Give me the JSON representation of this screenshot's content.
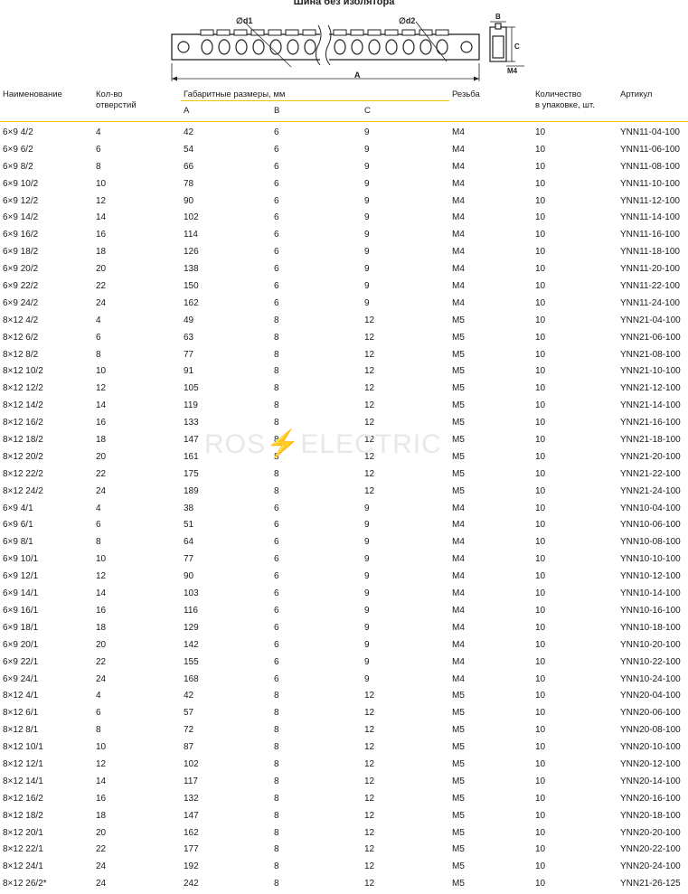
{
  "title": "Шина без изолятора",
  "drawing": {
    "d1_label": "∅d1",
    "d2_label": "∅d2",
    "a_label": "A",
    "b_label": "B",
    "c_label": "C",
    "m_label": "M4"
  },
  "header": {
    "name": "Наименование",
    "holes_line1": "Кол-во",
    "holes_line2": "отверстий",
    "dims": "Габаритные размеры, мм",
    "dim_a": "A",
    "dim_b": "B",
    "dim_c": "C",
    "thread": "Резьба",
    "qty_line1": "Количество",
    "qty_line2": "в упаковке, шт.",
    "article": "Артикул"
  },
  "watermark": {
    "left": "ROS",
    "bolt": "⚡",
    "right": "ELECTRIC"
  },
  "rows": [
    [
      "6×9 4/2",
      "4",
      "42",
      "6",
      "9",
      "M4",
      "10",
      "YNN11-04-100"
    ],
    [
      "6×9 6/2",
      "6",
      "54",
      "6",
      "9",
      "M4",
      "10",
      "YNN11-06-100"
    ],
    [
      "6×9 8/2",
      "8",
      "66",
      "6",
      "9",
      "M4",
      "10",
      "YNN11-08-100"
    ],
    [
      "6×9 10/2",
      "10",
      "78",
      "6",
      "9",
      "M4",
      "10",
      "YNN11-10-100"
    ],
    [
      "6×9 12/2",
      "12",
      "90",
      "6",
      "9",
      "M4",
      "10",
      "YNN11-12-100"
    ],
    [
      "6×9 14/2",
      "14",
      "102",
      "6",
      "9",
      "M4",
      "10",
      "YNN11-14-100"
    ],
    [
      "6×9 16/2",
      "16",
      "114",
      "6",
      "9",
      "M4",
      "10",
      "YNN11-16-100"
    ],
    [
      "6×9 18/2",
      "18",
      "126",
      "6",
      "9",
      "M4",
      "10",
      "YNN11-18-100"
    ],
    [
      "6×9 20/2",
      "20",
      "138",
      "6",
      "9",
      "M4",
      "10",
      "YNN11-20-100"
    ],
    [
      "6×9 22/2",
      "22",
      "150",
      "6",
      "9",
      "M4",
      "10",
      "YNN11-22-100"
    ],
    [
      "6×9 24/2",
      "24",
      "162",
      "6",
      "9",
      "M4",
      "10",
      "YNN11-24-100"
    ],
    [
      "8×12 4/2",
      "4",
      "49",
      "8",
      "12",
      "M5",
      "10",
      "YNN21-04-100"
    ],
    [
      "8×12 6/2",
      "6",
      "63",
      "8",
      "12",
      "M5",
      "10",
      "YNN21-06-100"
    ],
    [
      "8×12 8/2",
      "8",
      "77",
      "8",
      "12",
      "M5",
      "10",
      "YNN21-08-100"
    ],
    [
      "8×12 10/2",
      "10",
      "91",
      "8",
      "12",
      "M5",
      "10",
      "YNN21-10-100"
    ],
    [
      "8×12 12/2",
      "12",
      "105",
      "8",
      "12",
      "M5",
      "10",
      "YNN21-12-100"
    ],
    [
      "8×12 14/2",
      "14",
      "119",
      "8",
      "12",
      "M5",
      "10",
      "YNN21-14-100"
    ],
    [
      "8×12 16/2",
      "16",
      "133",
      "8",
      "12",
      "M5",
      "10",
      "YNN21-16-100"
    ],
    [
      "8×12 18/2",
      "18",
      "147",
      "8",
      "12",
      "M5",
      "10",
      "YNN21-18-100"
    ],
    [
      "8×12 20/2",
      "20",
      "161",
      "8",
      "12",
      "M5",
      "10",
      "YNN21-20-100"
    ],
    [
      "8×12 22/2",
      "22",
      "175",
      "8",
      "12",
      "M5",
      "10",
      "YNN21-22-100"
    ],
    [
      "8×12 24/2",
      "24",
      "189",
      "8",
      "12",
      "M5",
      "10",
      "YNN21-24-100"
    ],
    [
      "6×9 4/1",
      "4",
      "38",
      "6",
      "9",
      "M4",
      "10",
      "YNN10-04-100"
    ],
    [
      "6×9 6/1",
      "6",
      "51",
      "6",
      "9",
      "M4",
      "10",
      "YNN10-06-100"
    ],
    [
      "6×9 8/1",
      "8",
      "64",
      "6",
      "9",
      "M4",
      "10",
      "YNN10-08-100"
    ],
    [
      "6×9 10/1",
      "10",
      "77",
      "6",
      "9",
      "M4",
      "10",
      "YNN10-10-100"
    ],
    [
      "6×9 12/1",
      "12",
      "90",
      "6",
      "9",
      "M4",
      "10",
      "YNN10-12-100"
    ],
    [
      "6×9 14/1",
      "14",
      "103",
      "6",
      "9",
      "M4",
      "10",
      "YNN10-14-100"
    ],
    [
      "6×9 16/1",
      "16",
      "116",
      "6",
      "9",
      "M4",
      "10",
      "YNN10-16-100"
    ],
    [
      "6×9 18/1",
      "18",
      "129",
      "6",
      "9",
      "M4",
      "10",
      "YNN10-18-100"
    ],
    [
      "6×9 20/1",
      "20",
      "142",
      "6",
      "9",
      "M4",
      "10",
      "YNN10-20-100"
    ],
    [
      "6×9 22/1",
      "22",
      "155",
      "6",
      "9",
      "M4",
      "10",
      "YNN10-22-100"
    ],
    [
      "6×9 24/1",
      "24",
      "168",
      "6",
      "9",
      "M4",
      "10",
      "YNN10-24-100"
    ],
    [
      "8×12 4/1",
      "4",
      "42",
      "8",
      "12",
      "M5",
      "10",
      "YNN20-04-100"
    ],
    [
      "8×12 6/1",
      "6",
      "57",
      "8",
      "12",
      "M5",
      "10",
      "YNN20-06-100"
    ],
    [
      "8×12 8/1",
      "8",
      "72",
      "8",
      "12",
      "M5",
      "10",
      "YNN20-08-100"
    ],
    [
      "8×12 10/1",
      "10",
      "87",
      "8",
      "12",
      "M5",
      "10",
      "YNN20-10-100"
    ],
    [
      "8×12 12/1",
      "12",
      "102",
      "8",
      "12",
      "M5",
      "10",
      "YNN20-12-100"
    ],
    [
      "8×12 14/1",
      "14",
      "117",
      "8",
      "12",
      "M5",
      "10",
      "YNN20-14-100"
    ],
    [
      "8×12 16/2",
      "16",
      "132",
      "8",
      "12",
      "M5",
      "10",
      "YNN20-16-100"
    ],
    [
      "8×12 18/2",
      "18",
      "147",
      "8",
      "12",
      "M5",
      "10",
      "YNN20-18-100"
    ],
    [
      "8×12 20/1",
      "20",
      "162",
      "8",
      "12",
      "M5",
      "10",
      "YNN20-20-100"
    ],
    [
      "8×12 22/1",
      "22",
      "177",
      "8",
      "12",
      "M5",
      "10",
      "YNN20-22-100"
    ],
    [
      "8×12 24/1",
      "24",
      "192",
      "8",
      "12",
      "M5",
      "10",
      "YNN20-24-100"
    ],
    [
      "8×12 26/2*",
      "24",
      "242",
      "8",
      "12",
      "M5",
      "10",
      "YNN21-26-125"
    ]
  ]
}
